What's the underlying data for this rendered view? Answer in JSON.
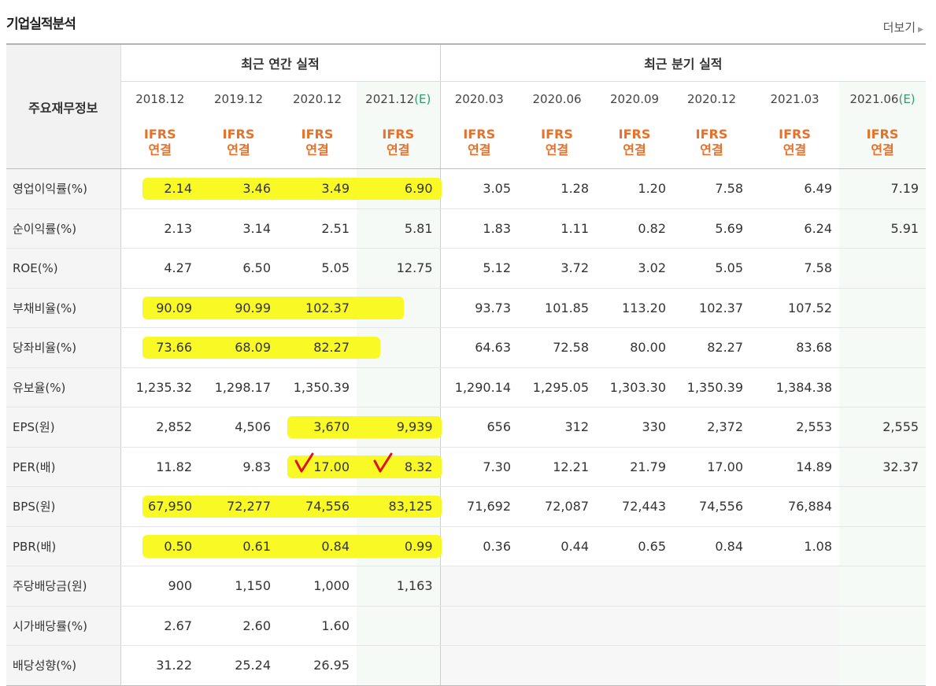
{
  "title": "기업실적분석",
  "more_label": "더보기",
  "corner_label": "주요재무정보",
  "groups": {
    "annual": "최근 연간 실적",
    "quarterly": "최근 분기 실적"
  },
  "annual_dates": [
    "2018.12",
    "2019.12",
    "2020.12",
    "2021.12"
  ],
  "quarter_dates": [
    "2020.03",
    "2020.06",
    "2020.09",
    "2020.12",
    "2021.03",
    "2021.06"
  ],
  "estimate_suffix": "(E)",
  "ifrs_line1": "IFRS",
  "ifrs_line2": "연결",
  "rows": [
    {
      "label": "영업이익률(%)",
      "values": [
        "2.14",
        "3.46",
        "3.49",
        "6.90",
        "3.05",
        "1.28",
        "1.20",
        "7.58",
        "6.49",
        "7.19"
      ]
    },
    {
      "label": "순이익률(%)",
      "values": [
        "2.13",
        "3.14",
        "2.51",
        "5.81",
        "1.83",
        "1.11",
        "0.82",
        "5.69",
        "6.24",
        "5.91"
      ]
    },
    {
      "label": "ROE(%)",
      "values": [
        "4.27",
        "6.50",
        "5.05",
        "12.75",
        "5.12",
        "3.72",
        "3.02",
        "5.05",
        "7.58",
        ""
      ]
    },
    {
      "label": "부채비율(%)",
      "values": [
        "90.09",
        "90.99",
        "102.37",
        "",
        "93.73",
        "101.85",
        "113.20",
        "102.37",
        "107.52",
        ""
      ]
    },
    {
      "label": "당좌비율(%)",
      "values": [
        "73.66",
        "68.09",
        "82.27",
        "",
        "64.63",
        "72.58",
        "80.00",
        "82.27",
        "83.68",
        ""
      ]
    },
    {
      "label": "유보율(%)",
      "values": [
        "1,235.32",
        "1,298.17",
        "1,350.39",
        "",
        "1,290.14",
        "1,295.05",
        "1,303.30",
        "1,350.39",
        "1,384.38",
        ""
      ]
    },
    {
      "label": "EPS(원)",
      "values": [
        "2,852",
        "4,506",
        "3,670",
        "9,939",
        "656",
        "312",
        "330",
        "2,372",
        "2,553",
        "2,555"
      ]
    },
    {
      "label": "PER(배)",
      "values": [
        "11.82",
        "9.83",
        "17.00",
        "8.32",
        "7.30",
        "12.21",
        "21.79",
        "17.00",
        "14.89",
        "32.37"
      ]
    },
    {
      "label": "BPS(원)",
      "values": [
        "67,950",
        "72,277",
        "74,556",
        "83,125",
        "71,692",
        "72,087",
        "72,443",
        "74,556",
        "76,884",
        ""
      ]
    },
    {
      "label": "PBR(배)",
      "values": [
        "0.50",
        "0.61",
        "0.84",
        "0.99",
        "0.36",
        "0.44",
        "0.65",
        "0.84",
        "1.08",
        ""
      ]
    },
    {
      "label": "주당배당금(원)",
      "values": [
        "900",
        "1,150",
        "1,000",
        "1,163",
        "",
        "",
        "",
        "",
        "",
        ""
      ]
    },
    {
      "label": "시가배당률(%)",
      "values": [
        "2.67",
        "2.60",
        "1.60",
        "",
        "",
        "",
        "",
        "",
        "",
        ""
      ]
    },
    {
      "label": "배당성향(%)",
      "values": [
        "31.22",
        "25.24",
        "26.95",
        "",
        "",
        "",
        "",
        "",
        "",
        ""
      ]
    }
  ],
  "colors": {
    "ifrs": "#e8712a",
    "estimate": "#2e9e6a",
    "highlight": "#f8f813",
    "check": "#e0101a"
  }
}
